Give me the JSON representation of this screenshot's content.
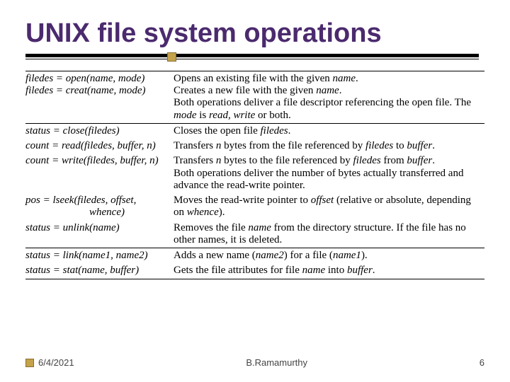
{
  "title": "UNIX file system operations",
  "rows": {
    "r1_left": "filedes = open(name, mode)\nfiledes = creat(name, mode)",
    "r1_right_a": "Opens an existing file with the given ",
    "r1_right_b": "name",
    "r1_right_c": ".\nCreates a new file with the given ",
    "r1_right_d": "name",
    "r1_right_e": ".\nBoth operations deliver a file descriptor referencing the open file. The ",
    "r1_right_f": "mode",
    "r1_right_g": " is ",
    "r1_right_h": "read, write",
    "r1_right_i": " or both.",
    "r2_left": "status = close(filedes)",
    "r2_right_a": "Closes the open file ",
    "r2_right_b": "filedes",
    "r2_right_c": ".",
    "r3_left": "count = read(filedes, buffer, n)",
    "r3_right_a": "Transfers ",
    "r3_right_b": "n",
    "r3_right_c": " bytes from the file referenced by ",
    "r3_right_d": "filedes",
    "r3_right_e": " to ",
    "r3_right_f": "buffer",
    "r3_right_g": ".",
    "r4_left": "count = write(filedes, buffer, n)",
    "r4_right_a": "Transfers ",
    "r4_right_b": "n",
    "r4_right_c": " bytes to the file referenced by ",
    "r4_right_d": "filedes",
    "r4_right_e": " from ",
    "r4_right_f": "buffer",
    "r4_right_g": ".\nBoth operations deliver the number of bytes actually transferred and advance the read-write pointer.",
    "r5_left": "pos = lseek(filedes, offset,\n                        whence)",
    "r5_right_a": "Moves the read-write pointer to ",
    "r5_right_b": "offset",
    "r5_right_c": " (relative or absolute, depending on ",
    "r5_right_d": "whence",
    "r5_right_e": ").",
    "r6_left": "status = unlink(name)",
    "r6_right_a": "Removes the file ",
    "r6_right_b": "name",
    "r6_right_c": " from the directory structure. If the file has no other names, it is deleted.",
    "r7_left": "status = link(name1, name2)",
    "r7_right_a": "Adds a new name (",
    "r7_right_b": "name2",
    "r7_right_c": ") for a file (",
    "r7_right_d": "name1",
    "r7_right_e": ").",
    "r8_left": "status = stat(name, buffer)",
    "r8_right_a": "Gets the file attributes for file ",
    "r8_right_b": "name",
    "r8_right_c": " into ",
    "r8_right_d": "buffer",
    "r8_right_e": "."
  },
  "footer": {
    "date": "6/4/2021",
    "author": "B.Ramamurthy",
    "page": "6"
  }
}
